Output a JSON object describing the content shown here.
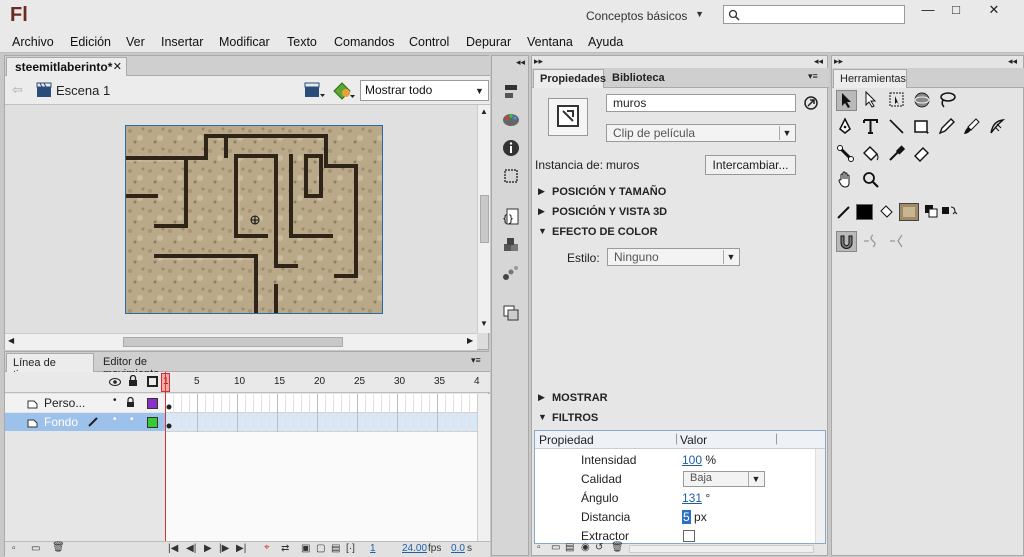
{
  "app": {
    "logo": "Fl",
    "workspace": "Conceptos básicos"
  },
  "window": {
    "minimize": "—",
    "maximize": "□",
    "close": "✕"
  },
  "menu": [
    "Archivo",
    "Edición",
    "Ver",
    "Insertar",
    "Modificar",
    "Texto",
    "Comandos",
    "Control",
    "Depurar",
    "Ventana",
    "Ayuda"
  ],
  "document": {
    "tab": "steemitlaberinto*",
    "scene": "Escena 1",
    "zoom": "Mostrar todo"
  },
  "timeline": {
    "tabs": [
      "Línea de tiempo",
      "Editor de movimiento"
    ],
    "frame_numbers": [
      "1",
      "5",
      "10",
      "15",
      "20",
      "25",
      "30",
      "35",
      "4"
    ],
    "layers": [
      {
        "name": "Perso...",
        "color": "#8b2fc9",
        "selected": false
      },
      {
        "name": "Fondo",
        "color": "#33cc33",
        "selected": true
      }
    ],
    "footer": {
      "frame": "1",
      "fps": "24.00",
      "fps_unit": "fps",
      "time": "0.0",
      "time_unit": "s"
    }
  },
  "properties": {
    "tabs": [
      "Propiedades",
      "Biblioteca"
    ],
    "instance_name": "muros",
    "symbol_type": "Clip de película",
    "instance_label": "Instancia de:",
    "instance_of": "muros",
    "swap_button": "Intercambiar...",
    "sections": {
      "position": "POSICIÓN Y TAMAÑO",
      "position3d": "POSICIÓN Y VISTA 3D",
      "color": "EFECTO DE COLOR",
      "display": "MOSTRAR",
      "filters": "FILTROS"
    },
    "style_label": "Estilo:",
    "style_value": "Ninguno",
    "filter_header": {
      "prop": "Propiedad",
      "value": "Valor"
    },
    "filters": [
      {
        "name": "Intensidad",
        "value": "100",
        "unit": "%"
      },
      {
        "name": "Calidad",
        "value": "Baja"
      },
      {
        "name": "Ángulo",
        "value": "131",
        "unit": "°"
      },
      {
        "name": "Distancia",
        "value": "5",
        "unit": "px"
      },
      {
        "name": "Extractor",
        "value": ""
      }
    ]
  },
  "tools": {
    "title": "Herramientas"
  }
}
